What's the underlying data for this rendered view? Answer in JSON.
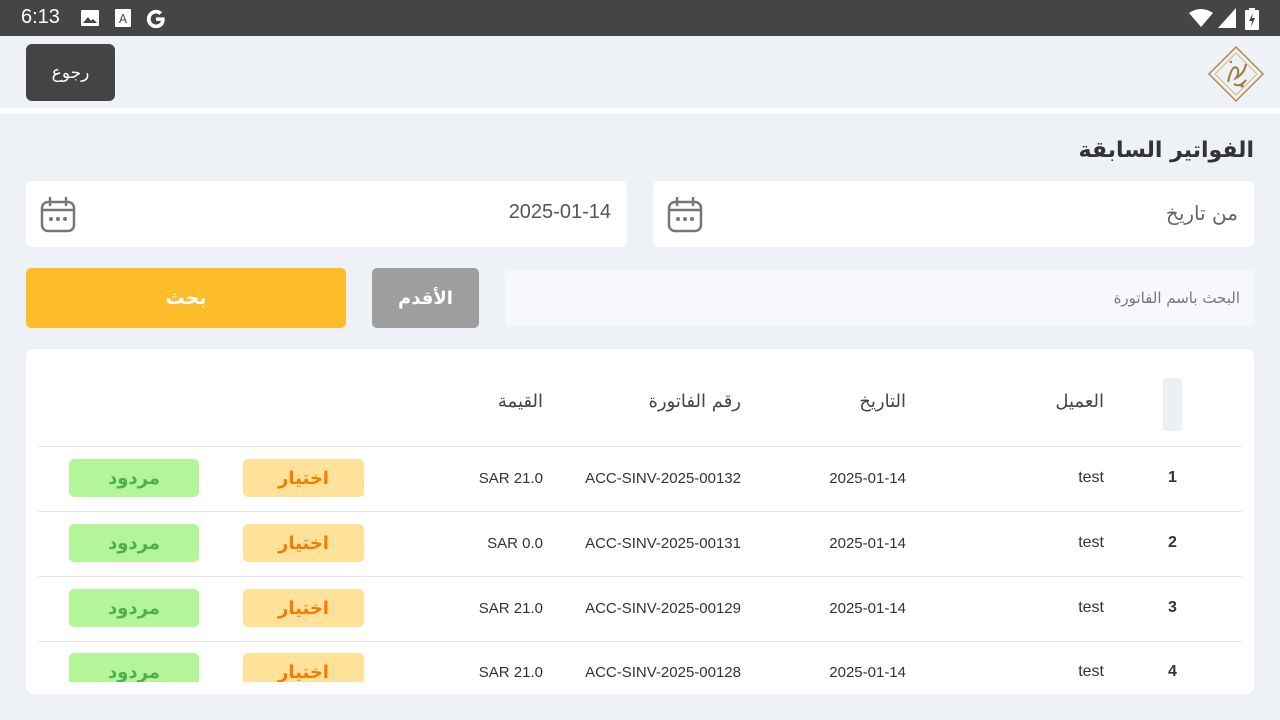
{
  "status_bar": {
    "time": "6:13",
    "icons_left": [
      "image-icon",
      "app-icon",
      "google-icon"
    ],
    "icons_right": [
      "wifi-icon",
      "signal-icon",
      "battery-icon"
    ]
  },
  "header": {
    "back_label": "رجوع",
    "logo": "app-logo"
  },
  "page": {
    "title": "الفواتير السابقة"
  },
  "filters": {
    "date_from_placeholder": "من تاريخ",
    "date_to_value": "2025-01-14",
    "search_placeholder": "البحث باسم الفاتورة",
    "search_button": "بحث",
    "oldest_button": "الأقدم"
  },
  "table": {
    "columns": {
      "client": "العميل",
      "date": "التاريخ",
      "invoice_number": "رقم الفاتورة",
      "value": "القيمة"
    },
    "rows": [
      {
        "num": "1",
        "client": "test",
        "date": "2025-01-14",
        "invoice": "ACC-SINV-2025-00132",
        "value": "SAR 21.0",
        "choose": "اختيار",
        "returned": "مردود"
      },
      {
        "num": "2",
        "client": "test",
        "date": "2025-01-14",
        "invoice": "ACC-SINV-2025-00131",
        "value": "SAR 0.0",
        "choose": "اختيار",
        "returned": "مردود"
      },
      {
        "num": "3",
        "client": "test",
        "date": "2025-01-14",
        "invoice": "ACC-SINV-2025-00129",
        "value": "SAR 21.0",
        "choose": "اختيار",
        "returned": "مردود"
      },
      {
        "num": "4",
        "client": "test",
        "date": "2025-01-14",
        "invoice": "ACC-SINV-2025-00128",
        "value": "SAR 21.0",
        "choose": "اختيار",
        "returned": "مردود"
      }
    ]
  },
  "colors": {
    "search_button": "#fdbd2b",
    "oldest_button": "#9e9e9e",
    "choose_bg": "#ffe29a",
    "choose_text": "#f57c00",
    "returned_bg": "#b5f59a",
    "returned_text": "#4caf50",
    "back_button": "#444444"
  }
}
